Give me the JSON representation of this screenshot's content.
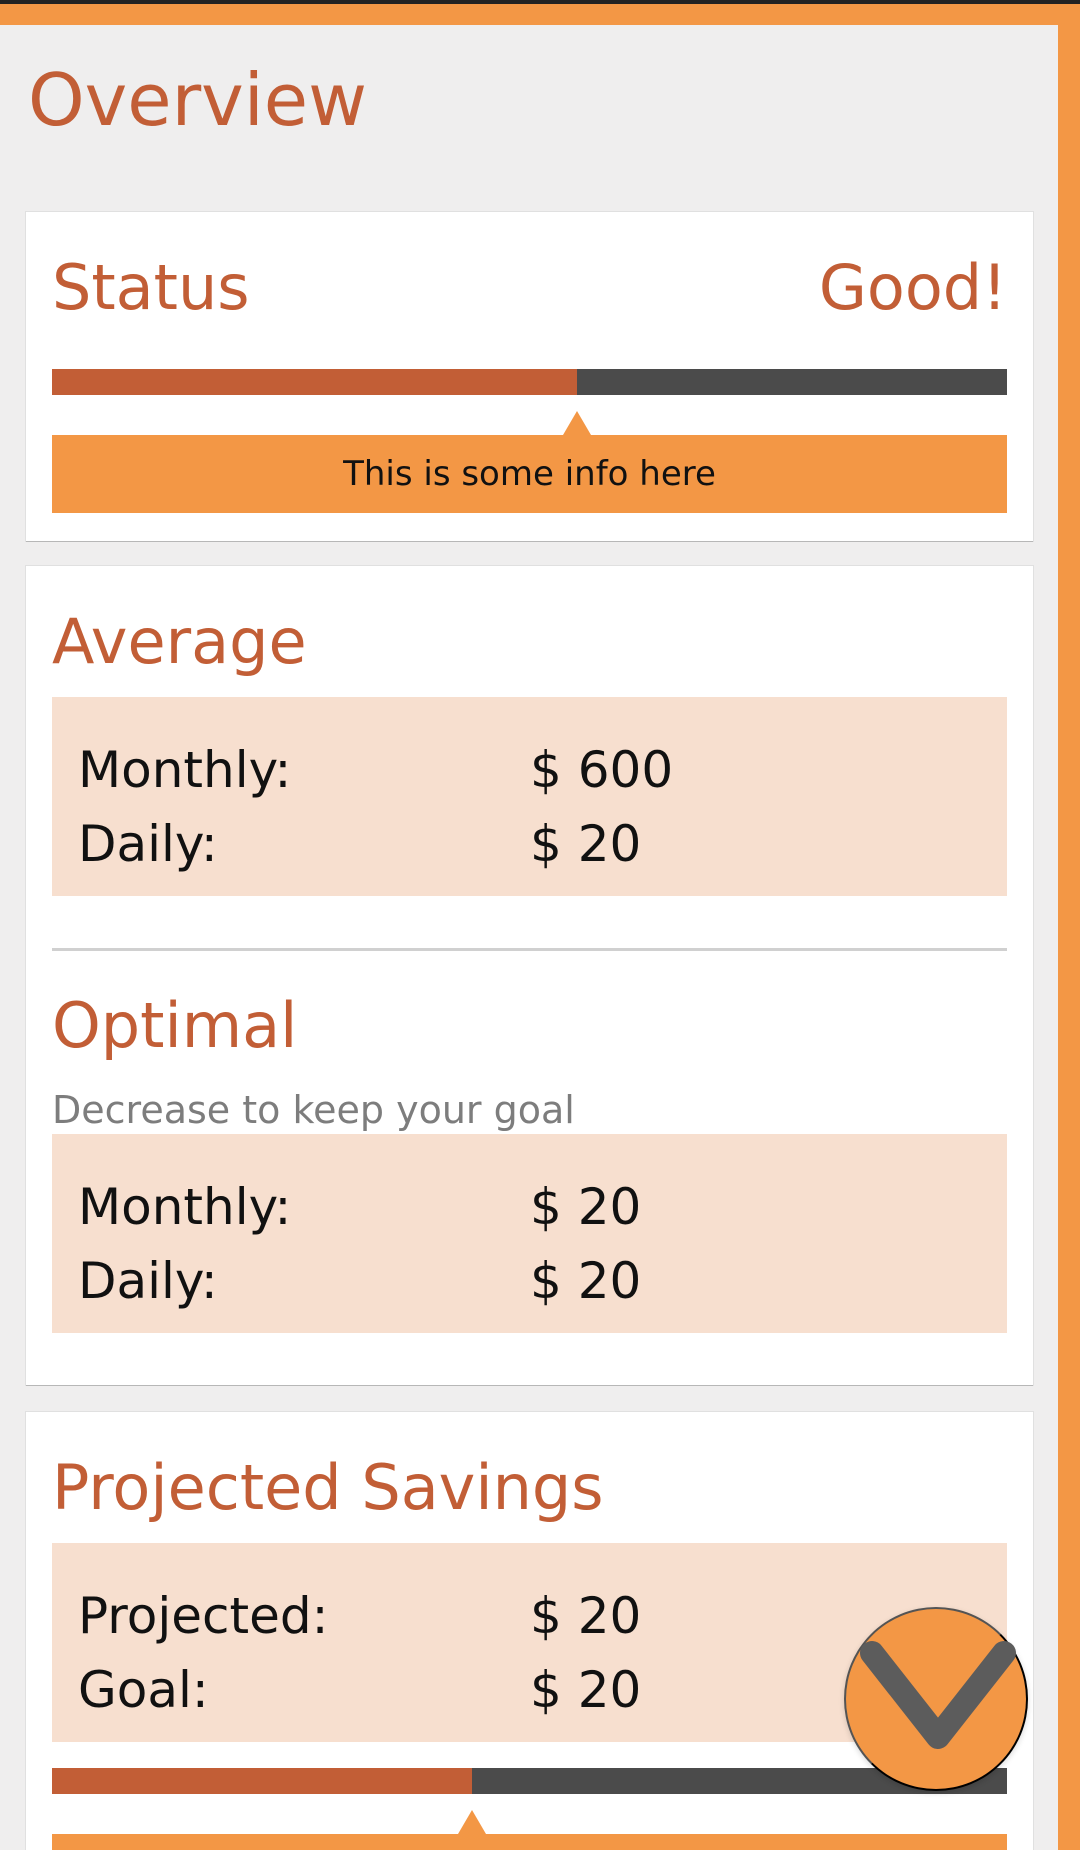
{
  "colors": {
    "accent": "#c25e36",
    "orange": "#f39745",
    "dark_track": "#4b4b4b",
    "panel_bg": "#f7dfcf",
    "page_bg": "#efeeee"
  },
  "page": {
    "title": "Overview"
  },
  "status_card": {
    "label": "Status",
    "value": "Good!",
    "progress": 0.55,
    "info_text": "This is some info here"
  },
  "average_card": {
    "title": "Average",
    "rows": [
      {
        "label": "Monthly:",
        "value": "$ 600"
      },
      {
        "label": "Daily:",
        "value": "$ 20"
      }
    ]
  },
  "optimal_card": {
    "title": "Optimal",
    "subtitle": "Decrease to keep your goal",
    "rows": [
      {
        "label": "Monthly:",
        "value": "$ 20"
      },
      {
        "label": "Daily:",
        "value": "$ 20"
      }
    ]
  },
  "projected_card": {
    "title": "Projected Savings",
    "rows": [
      {
        "label": "Projected:",
        "value": "$ 20"
      },
      {
        "label": "Goal:",
        "value": "$ 20"
      }
    ],
    "progress": 0.44
  },
  "fab": {
    "icon": "chevron-down-icon"
  }
}
